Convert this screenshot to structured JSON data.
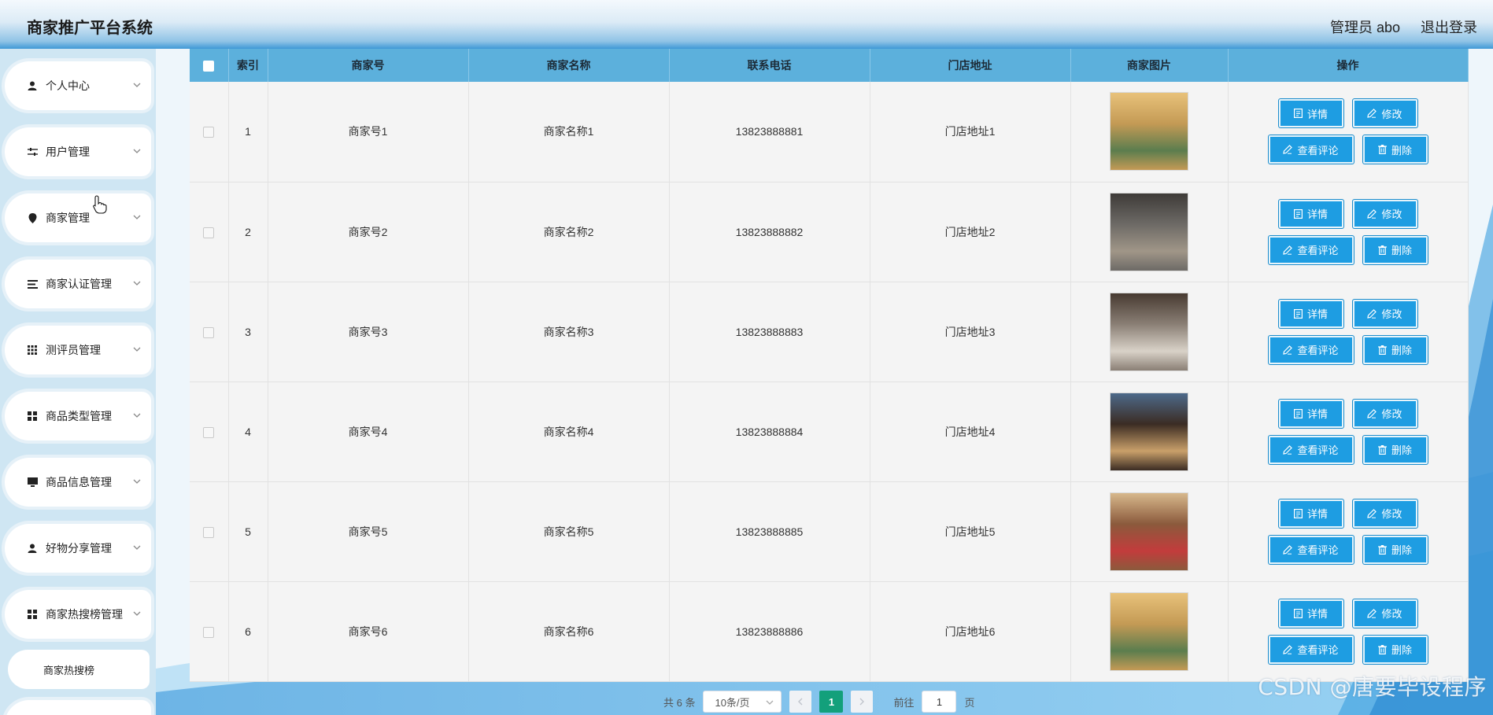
{
  "header": {
    "title": "商家推广平台系统",
    "admin_label": "管理员 abo",
    "logout_label": "退出登录"
  },
  "sidebar": {
    "items": [
      {
        "label": "个人中心",
        "icon": "user-icon"
      },
      {
        "label": "用户管理",
        "icon": "sliders-icon"
      },
      {
        "label": "商家管理",
        "icon": "location-pin-icon"
      },
      {
        "label": "商家认证管理",
        "icon": "list-icon"
      },
      {
        "label": "测评员管理",
        "icon": "grid-icon"
      },
      {
        "label": "商品类型管理",
        "icon": "apps-icon"
      },
      {
        "label": "商品信息管理",
        "icon": "monitor-icon"
      },
      {
        "label": "好物分享管理",
        "icon": "user-icon"
      },
      {
        "label": "商家热搜榜管理",
        "icon": "apps-icon"
      }
    ],
    "sub_item": "商家热搜榜"
  },
  "table": {
    "columns": [
      "索引",
      "商家号",
      "商家名称",
      "联系电话",
      "门店地址",
      "商家图片",
      "操作"
    ],
    "rows": [
      {
        "index": "1",
        "merchant_no": "商家号1",
        "name": "商家名称1",
        "phone": "13823888881",
        "address": "门店地址1"
      },
      {
        "index": "2",
        "merchant_no": "商家号2",
        "name": "商家名称2",
        "phone": "13823888882",
        "address": "门店地址2"
      },
      {
        "index": "3",
        "merchant_no": "商家号3",
        "name": "商家名称3",
        "phone": "13823888883",
        "address": "门店地址3"
      },
      {
        "index": "4",
        "merchant_no": "商家号4",
        "name": "商家名称4",
        "phone": "13823888884",
        "address": "门店地址4"
      },
      {
        "index": "5",
        "merchant_no": "商家号5",
        "name": "商家名称5",
        "phone": "13823888885",
        "address": "门店地址5"
      },
      {
        "index": "6",
        "merchant_no": "商家号6",
        "name": "商家名称6",
        "phone": "13823888886",
        "address": "门店地址6"
      }
    ],
    "actions": {
      "detail": "详情",
      "edit": "修改",
      "comments": "查看评论",
      "delete": "删除"
    }
  },
  "pagination": {
    "total": "共 6 条",
    "page_size": "10条/页",
    "current_page": "1",
    "goto_label": "前往",
    "goto_value": "1",
    "page_suffix": "页"
  },
  "watermark": "CSDN @唐要毕设程序",
  "colors": {
    "header_blue": "#3f98d6",
    "table_header": "#5cb0dc",
    "action_button": "#1e9de2",
    "active_page": "#13a07b"
  }
}
